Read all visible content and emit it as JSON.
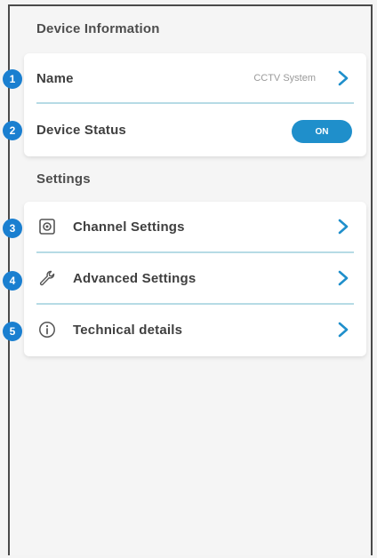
{
  "sections": {
    "device_info_title": "Device Information",
    "settings_title": "Settings"
  },
  "device": {
    "name_label": "Name",
    "name_value": "CCTV System",
    "status_label": "Device Status",
    "status_toggle": "ON"
  },
  "settings": {
    "items": [
      {
        "label": "Channel Settings",
        "icon": "channel-icon"
      },
      {
        "label": "Advanced Settings",
        "icon": "wrench-icon"
      },
      {
        "label": "Technical details",
        "icon": "info-icon"
      }
    ]
  },
  "badges": [
    "1",
    "2",
    "3",
    "4",
    "5"
  ],
  "colors": {
    "accent": "#1f8fcb",
    "badge": "#1a7fd0",
    "divider": "#b6dbe5",
    "background": "#f4f4f4"
  }
}
